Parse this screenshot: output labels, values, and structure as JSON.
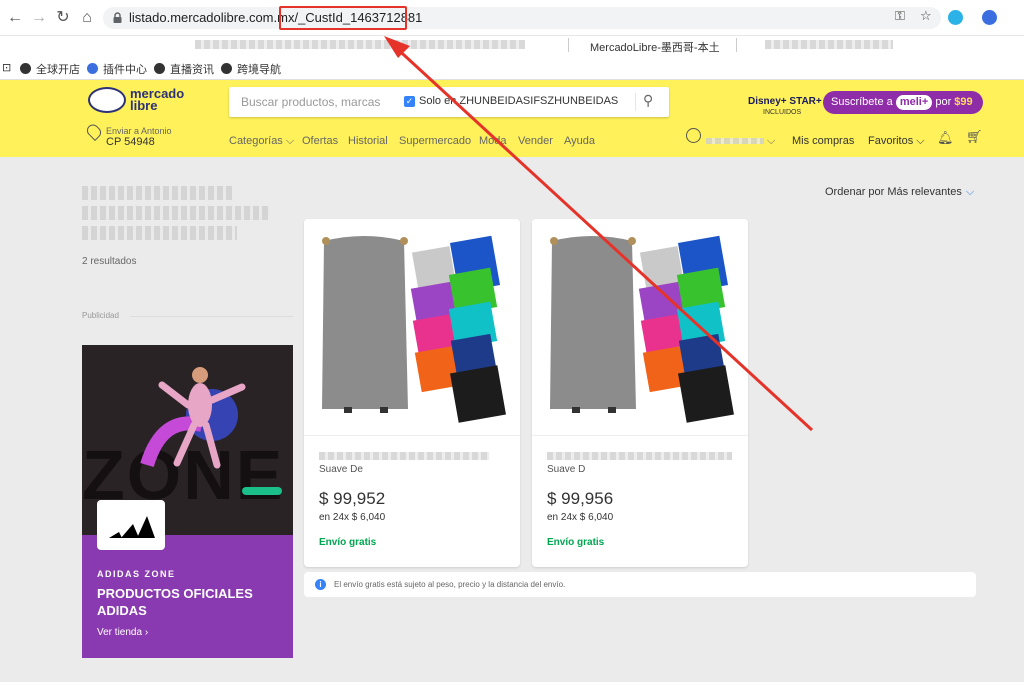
{
  "browser": {
    "url_host": "listado.mercadolibre.com.mx/",
    "url_path": "_CustId_1463712881",
    "tab_title": "MercadoLibre-墨西哥-本土"
  },
  "bookmarks": [
    {
      "label": "全球开店",
      "icon": "globe-icon"
    },
    {
      "label": "插件中心",
      "icon": "plugin-icon"
    },
    {
      "label": "直播资讯",
      "icon": "globe-icon"
    },
    {
      "label": "跨境导航",
      "icon": "globe-icon"
    }
  ],
  "header": {
    "logo_line1": "mercado",
    "logo_line2": "libre",
    "search_placeholder": "Buscar productos, marcas",
    "search_filter_label": "Solo en ZHUNBEIDASIFSZHUNBEIDASIFS...",
    "disney_label": "Disney+ STAR+",
    "disney_sub": "INCLUIDOS",
    "meli_prefix": "Suscríbete a",
    "meli_badge": "meli+",
    "meli_por": "por",
    "meli_price": "$99",
    "location_label": "Enviar a Antonio",
    "location_cp": "CP 54948",
    "nav": [
      "Categorías ⌵",
      "Ofertas",
      "Historial",
      "Supermercado",
      "Moda",
      "Vender",
      "Ayuda"
    ],
    "user_caret": "⌵",
    "mis_compras": "Mis compras",
    "favoritos": "Favoritos ⌵"
  },
  "results": {
    "count": "2 resultados",
    "publicidad": "Publicidad",
    "sort_label": "Ordenar por",
    "sort_value": "Más relevantes"
  },
  "ad": {
    "eyebrow": "ADIDAS ZONE",
    "title": "PRODUCTOS OFICIALES ADIDAS",
    "cta": "Ver tienda  ›",
    "zone_text": "ZONE"
  },
  "products": [
    {
      "subtitle": "Suave De",
      "price": "$ 99,952",
      "installments": "en 24x $ 6,040",
      "shipping": "Envío gratis"
    },
    {
      "subtitle": "Suave D",
      "price": "$ 99,956",
      "installments": "en 24x $ 6,040",
      "shipping": "Envío gratis"
    }
  ],
  "notice": "El envío gratis está sujeto al peso, precio y la distancia del envío.",
  "colors": {
    "ml_yellow": "#fff159",
    "meli_purple": "#8f2da8",
    "ship_green": "#00a650",
    "annotation_red": "#e5332a"
  }
}
